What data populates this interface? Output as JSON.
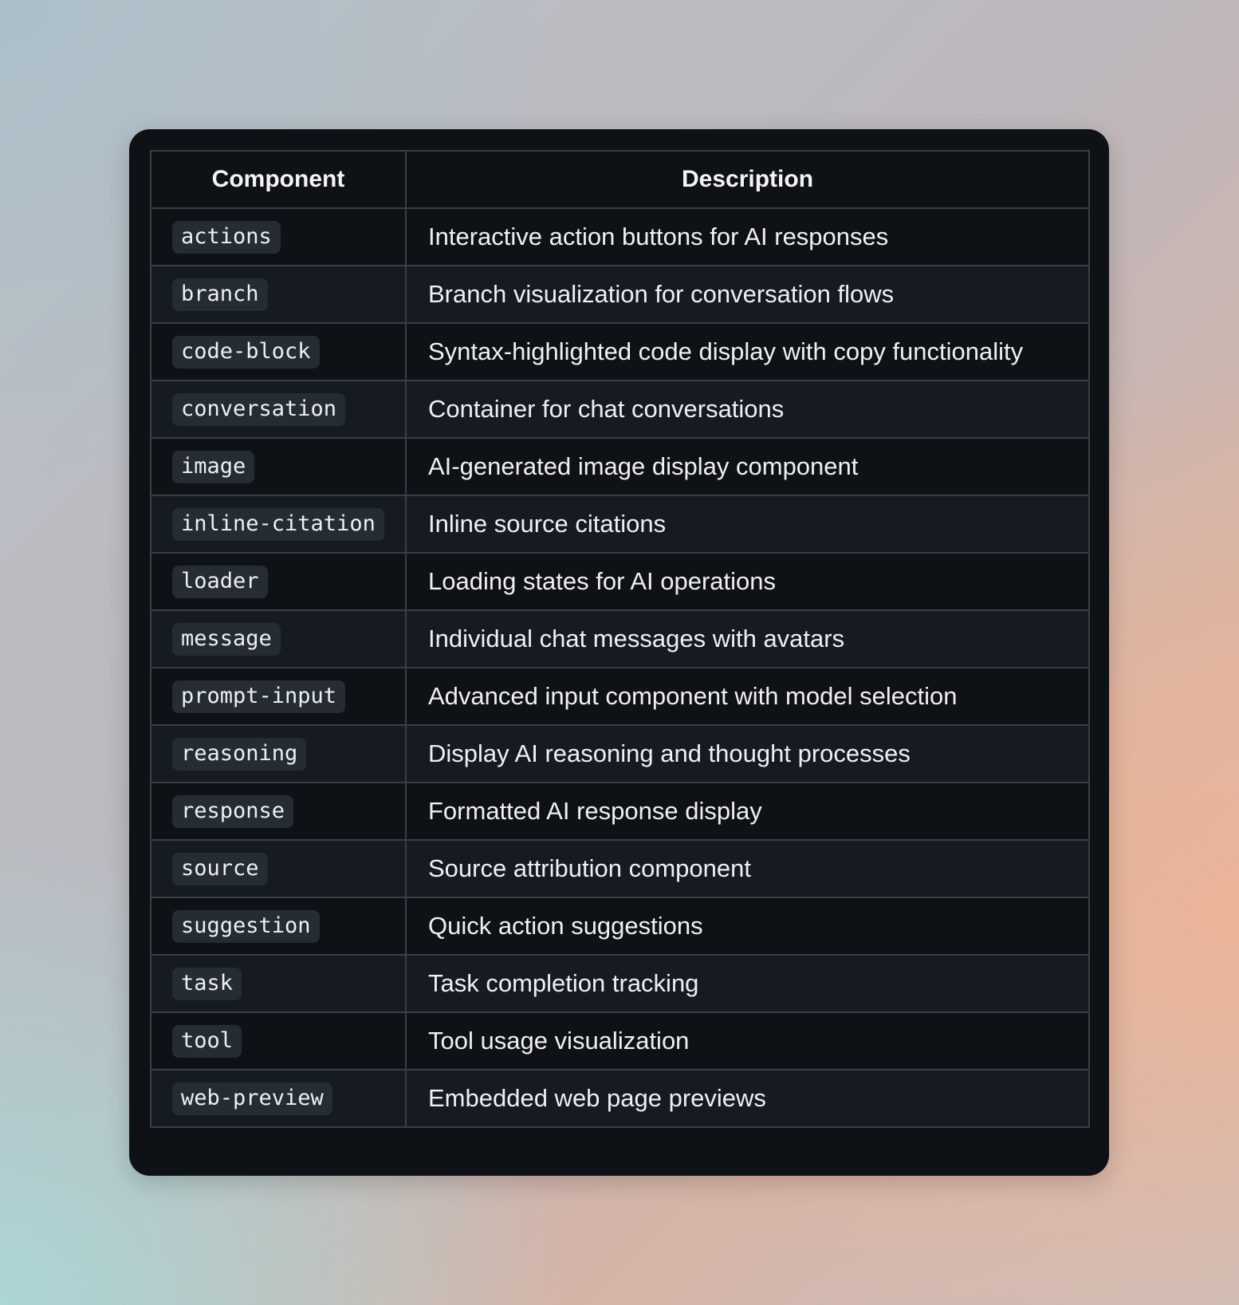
{
  "table": {
    "headers": {
      "component": "Component",
      "description": "Description"
    },
    "rows": [
      {
        "component": "actions",
        "description": "Interactive action buttons for AI responses"
      },
      {
        "component": "branch",
        "description": "Branch visualization for conversation flows"
      },
      {
        "component": "code-block",
        "description": "Syntax-highlighted code display with copy functionality"
      },
      {
        "component": "conversation",
        "description": "Container for chat conversations"
      },
      {
        "component": "image",
        "description": "AI-generated image display component"
      },
      {
        "component": "inline-citation",
        "description": "Inline source citations"
      },
      {
        "component": "loader",
        "description": "Loading states for AI operations"
      },
      {
        "component": "message",
        "description": "Individual chat messages with avatars"
      },
      {
        "component": "prompt-input",
        "description": "Advanced input component with model selection"
      },
      {
        "component": "reasoning",
        "description": "Display AI reasoning and thought processes"
      },
      {
        "component": "response",
        "description": "Formatted AI response display"
      },
      {
        "component": "source",
        "description": "Source attribution component"
      },
      {
        "component": "suggestion",
        "description": "Quick action suggestions"
      },
      {
        "component": "task",
        "description": "Task completion tracking"
      },
      {
        "component": "tool",
        "description": "Tool usage visualization"
      },
      {
        "component": "web-preview",
        "description": "Embedded web page previews"
      }
    ]
  }
}
